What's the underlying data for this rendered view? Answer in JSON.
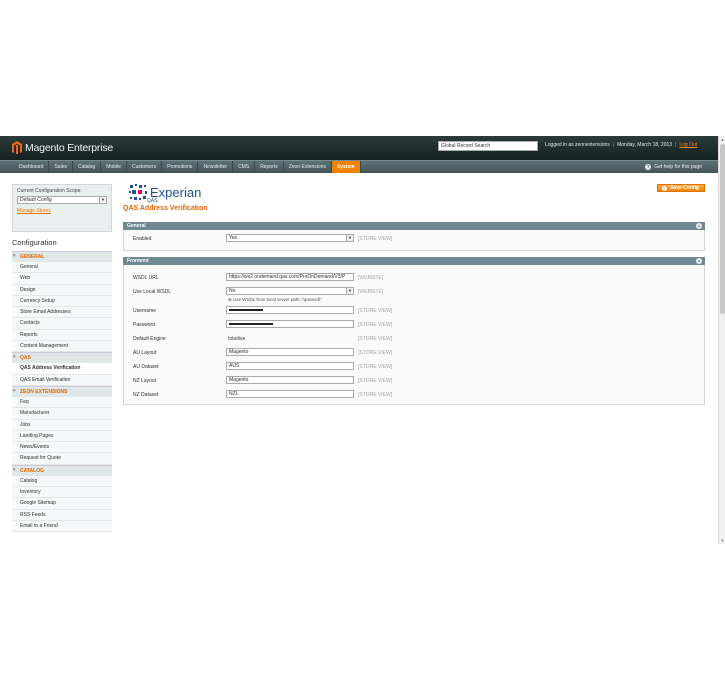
{
  "header": {
    "brand": "Magento",
    "edition": "Enterprise",
    "global_search": "Global Record Search",
    "logged_in": "Logged in as zeonextensions",
    "date": "Monday, March 18, 2013",
    "logout": "Log Out"
  },
  "nav": {
    "items": [
      "Dashboard",
      "Sales",
      "Catalog",
      "Mobile",
      "Customers",
      "Promotions",
      "Newsletter",
      "CMS",
      "Reports",
      "Zeon Extensions",
      "System"
    ],
    "active": "System",
    "help": "Get help for this page"
  },
  "sidebar": {
    "scope_label": "Current Configuration Scope:",
    "scope_value": "Default Config",
    "manage_stores": "Manage Stores",
    "title": "Configuration",
    "sections": [
      {
        "head": "GENERAL",
        "items": [
          "General",
          "Web",
          "Design",
          "Currency Setup",
          "Store Email Addresses",
          "Contacts",
          "Reports",
          "Content Management"
        ]
      },
      {
        "head": "QAS",
        "items": [
          "QAS Address Verification",
          "QAS Email Verification"
        ]
      },
      {
        "head": "ZEON EXTENSIONS",
        "items": [
          "Faq",
          "Manufacturer",
          "Jobs",
          "Landing Pages",
          "News/Events",
          "Request for Quote"
        ]
      },
      {
        "head": "CATALOG",
        "items": [
          "Catalog",
          "Inventory",
          "Google Sitemap",
          "RSS Feeds",
          "Email to a Friend"
        ]
      }
    ],
    "active_item": "QAS Address Verification"
  },
  "main": {
    "logo_name": "Experian",
    "logo_sub": "QAS",
    "title": "QAS Address Verification",
    "save": "Save Config",
    "general": {
      "head": "General",
      "enabled_label": "Enabled",
      "enabled_value": "Yes",
      "enabled_scope": "[STORE VIEW]"
    },
    "frontend": {
      "head": "Frontend",
      "fields": [
        {
          "label": "WSDL URL",
          "value": "https://ws2.ondemand.qas.com/ProOnDemand/V3/P",
          "scope": "[WEBSITE]",
          "kind": "input"
        },
        {
          "label": "Use Local WSDL",
          "value": "No",
          "scope": "[WEBSITE]",
          "kind": "select",
          "note": "Use WSDL from local server path \"/qaswsdl\""
        },
        {
          "label": "Username",
          "value": "",
          "scope": "[STORE VIEW]",
          "kind": "masked"
        },
        {
          "label": "Password",
          "value": "",
          "scope": "[STORE VIEW]",
          "kind": "masked"
        },
        {
          "label": "Default Engine",
          "value": "Intuitive",
          "scope": "[STORE VIEW]",
          "kind": "plain"
        },
        {
          "label": "AU Layout",
          "value": "Magento",
          "scope": "[STORE VIEW]",
          "kind": "input"
        },
        {
          "label": "AU Dataset",
          "value": "AUS",
          "scope": "[STORE VIEW]",
          "kind": "input"
        },
        {
          "label": "NZ Layout",
          "value": "Magento",
          "scope": "[STORE VIEW]",
          "kind": "input"
        },
        {
          "label": "NZ Dataset",
          "value": "NZL",
          "scope": "[STORE VIEW]",
          "kind": "input"
        }
      ]
    }
  },
  "colors": {
    "accent": "#f18200",
    "header_bg": "#1d2a2a",
    "fieldset_head": "#6f8992",
    "brand_blue": "#1d4f91"
  }
}
